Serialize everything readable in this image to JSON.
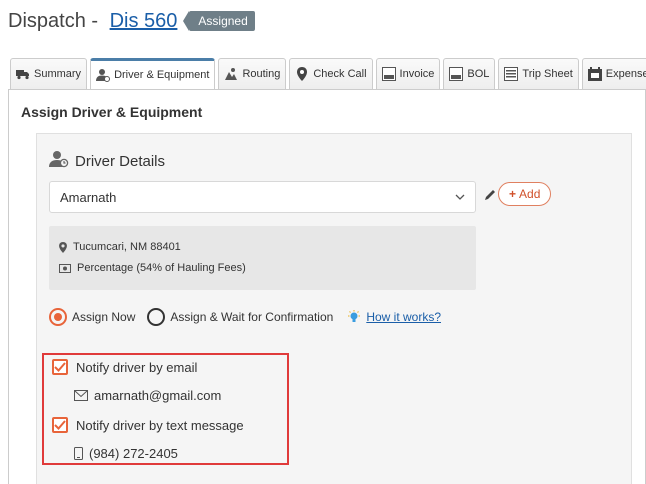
{
  "header": {
    "title": "Dispatch - ",
    "link": "Dis 560",
    "status": "Assigned"
  },
  "tabs": [
    {
      "label": "Summary",
      "icon": "truck-icon"
    },
    {
      "label": "Driver & Equipment",
      "icon": "driver-icon"
    },
    {
      "label": "Routing",
      "icon": "routing-icon"
    },
    {
      "label": "Check Call",
      "icon": "map-pin-icon"
    },
    {
      "label": "Invoice",
      "icon": "invoice-icon"
    },
    {
      "label": "BOL",
      "icon": "bol-icon"
    },
    {
      "label": "Trip Sheet",
      "icon": "trip-sheet-icon"
    },
    {
      "label": "Expenses",
      "icon": "expenses-icon"
    }
  ],
  "active_tab": "Driver & Equipment",
  "section": {
    "title": "Assign Driver & Equipment"
  },
  "driver": {
    "heading": "Driver Details",
    "selected": "Amarnath",
    "add_label": "Add",
    "location": "Tucumcari, NM 88401",
    "pay": "Percentage (54% of Hauling Fees)"
  },
  "assign": {
    "now_label": "Assign Now",
    "wait_label": "Assign & Wait for Confirmation",
    "how_link": "How it works?",
    "selected": "Assign Now"
  },
  "notify": {
    "email_label": "Notify driver by email",
    "email": "amarnath@gmail.com",
    "text_label": "Notify driver by text message",
    "phone": "(984) 272-2405"
  },
  "colors": {
    "accent": "#e8643a",
    "link": "#1a5ea8",
    "highlight": "#e03a3a",
    "badge": "#6f7f88"
  }
}
